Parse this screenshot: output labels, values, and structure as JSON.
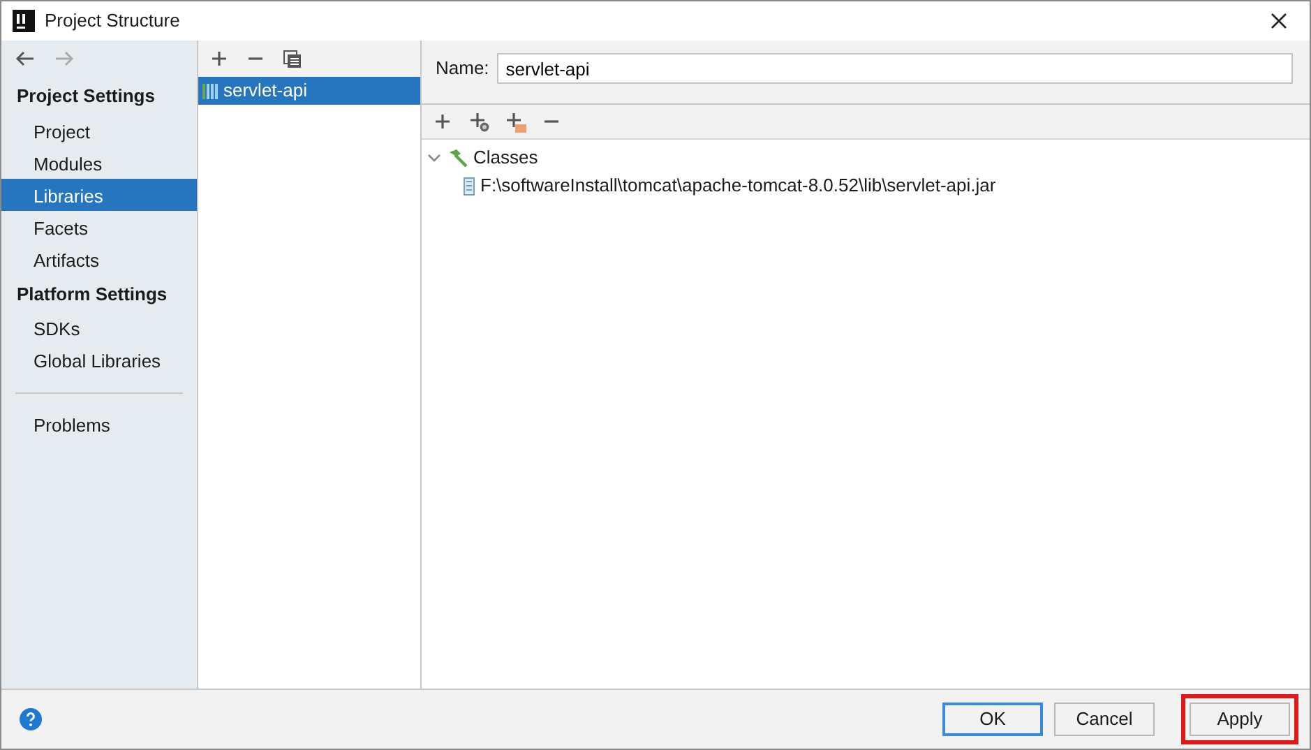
{
  "window": {
    "title": "Project Structure"
  },
  "sidebar": {
    "sections": [
      {
        "heading": "Project Settings",
        "items": [
          {
            "label": "Project",
            "selected": false
          },
          {
            "label": "Modules",
            "selected": false
          },
          {
            "label": "Libraries",
            "selected": true
          },
          {
            "label": "Facets",
            "selected": false
          },
          {
            "label": "Artifacts",
            "selected": false
          }
        ]
      },
      {
        "heading": "Platform Settings",
        "items": [
          {
            "label": "SDKs",
            "selected": false
          },
          {
            "label": "Global Libraries",
            "selected": false
          }
        ]
      }
    ],
    "extra_items": [
      {
        "label": "Problems",
        "selected": false
      }
    ]
  },
  "libraries": [
    {
      "label": "servlet-api",
      "selected": true
    }
  ],
  "detail": {
    "name_label": "Name:",
    "name_value": "servlet-api",
    "tree": [
      {
        "label": "Classes",
        "expanded": true,
        "children": [
          {
            "label": "F:\\softwareInstall\\tomcat\\apache-tomcat-8.0.52\\lib\\servlet-api.jar"
          }
        ]
      }
    ]
  },
  "buttons": [
    {
      "label": "OK",
      "kind": "default",
      "highlighted": false
    },
    {
      "label": "Cancel",
      "kind": "plain",
      "highlighted": false
    },
    {
      "label": "Apply",
      "kind": "plain",
      "highlighted": true
    }
  ]
}
